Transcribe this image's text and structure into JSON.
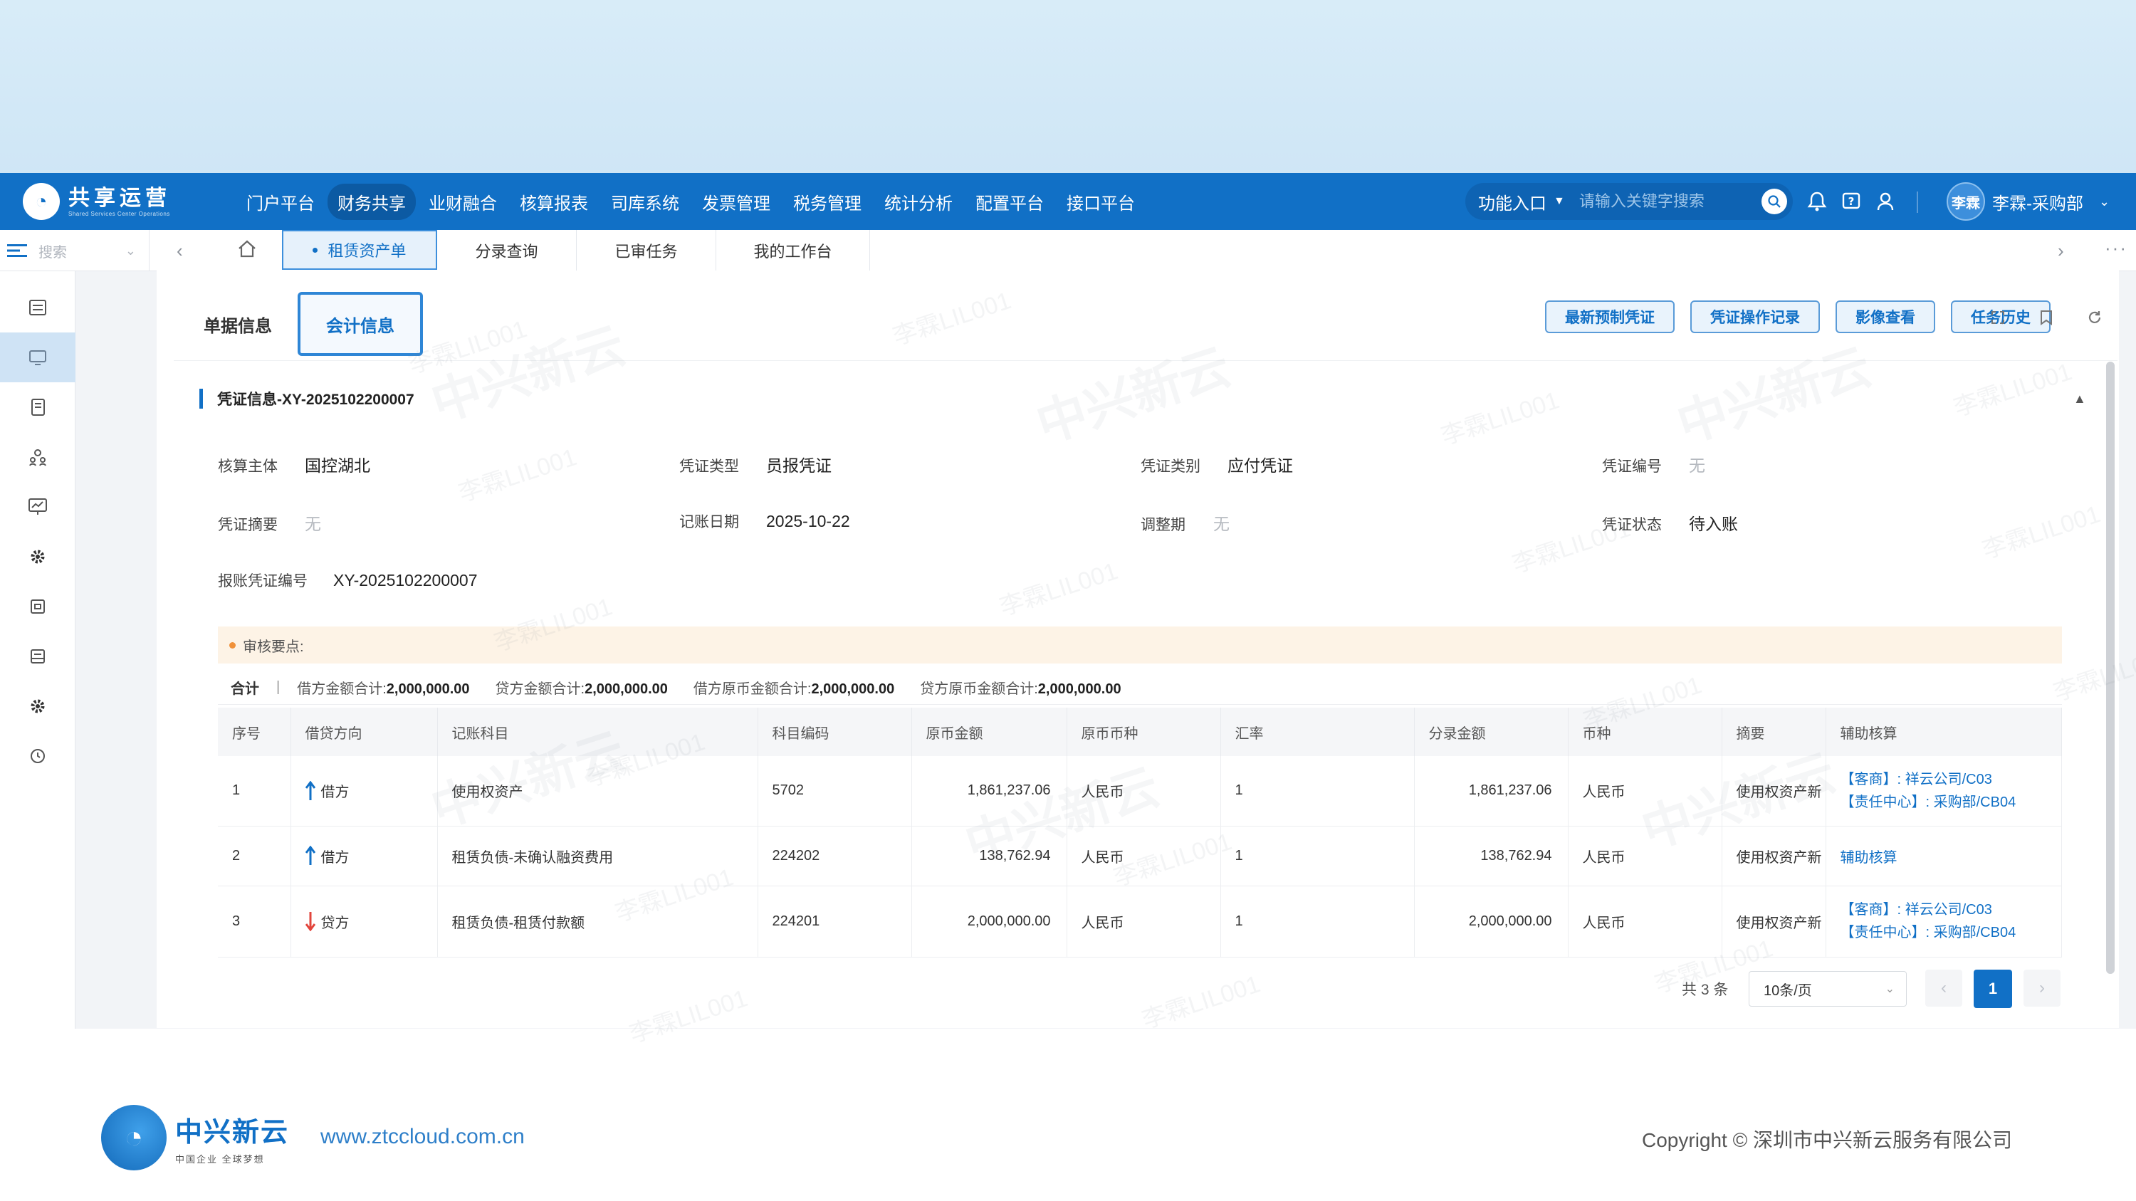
{
  "brand": {
    "name": "共享运营",
    "subtitle": "Shared Services Center Operations"
  },
  "nav": [
    "门户平台",
    "财务共享",
    "业财融合",
    "核算报表",
    "司库系统",
    "发票管理",
    "税务管理",
    "统计分析",
    "配置平台",
    "接口平台"
  ],
  "header": {
    "func_entry": "功能入口",
    "search_placeholder": "请输入关键字搜索",
    "user_avatar": "李霖",
    "user_name": "李霖-采购部"
  },
  "sidebar": {
    "search_label": "搜索"
  },
  "tabs": [
    "租赁资产单",
    "分录查询",
    "已审任务",
    "我的工作台"
  ],
  "panel_tabs": [
    "单据信息",
    "会计信息"
  ],
  "actions": [
    "最新预制凭证",
    "凭证操作记录",
    "影像查看",
    "任务历史"
  ],
  "voucher": {
    "title": "凭证信息-XY-2025102200007",
    "fields": {
      "entity_label": "核算主体",
      "entity": "国控湖北",
      "type_label": "凭证类型",
      "type": "员报凭证",
      "category_label": "凭证类别",
      "category": "应付凭证",
      "number_label": "凭证编号",
      "number": "无",
      "summary_label": "凭证摘要",
      "summary": "无",
      "date_label": "记账日期",
      "date": "2025-10-22",
      "period_label": "调整期",
      "period": "无",
      "status_label": "凭证状态",
      "status": "待入账",
      "report_label": "报账凭证编号",
      "report": "XY-2025102200007"
    }
  },
  "audit_label": "审核要点:",
  "totals": {
    "label": "合计",
    "items": [
      {
        "k": "借方金额合计:",
        "v": "2,000,000.00"
      },
      {
        "k": "贷方金额合计:",
        "v": "2,000,000.00"
      },
      {
        "k": "借方原币金额合计:",
        "v": "2,000,000.00"
      },
      {
        "k": "贷方原币金额合计:",
        "v": "2,000,000.00"
      }
    ]
  },
  "table": {
    "headers": [
      "序号",
      "借贷方向",
      "记账科目",
      "科目编码",
      "原币金额",
      "原币币种",
      "汇率",
      "分录金额",
      "币种",
      "摘要",
      "辅助核算"
    ],
    "rows": [
      {
        "no": "1",
        "dir": "借方",
        "subject": "使用权资产",
        "code": "5702",
        "orig": "1,861,237.06",
        "orig_cur": "人民币",
        "rate": "1",
        "amount": "1,861,237.06",
        "cur": "人民币",
        "summary": "使用权资产新",
        "aux1": "【客商】: 祥云公司/C03",
        "aux2": "【责任中心】: 采购部/CB04"
      },
      {
        "no": "2",
        "dir": "借方",
        "subject": "租赁负债-未确认融资费用",
        "code": "224202",
        "orig": "138,762.94",
        "orig_cur": "人民币",
        "rate": "1",
        "amount": "138,762.94",
        "cur": "人民币",
        "summary": "使用权资产新",
        "aux1": "辅助核算",
        "aux2": ""
      },
      {
        "no": "3",
        "dir": "贷方",
        "subject": "租赁负债-租赁付款额",
        "code": "224201",
        "orig": "2,000,000.00",
        "orig_cur": "人民币",
        "rate": "1",
        "amount": "2,000,000.00",
        "cur": "人民币",
        "summary": "使用权资产新",
        "aux1": "【客商】: 祥云公司/C03",
        "aux2": "【责任中心】: 采购部/CB04"
      }
    ]
  },
  "pager": {
    "total": "共 3 条",
    "size": "10条/页",
    "page": "1"
  },
  "watermark": {
    "text": "李霖LIL001",
    "brand": "中兴新云"
  },
  "footer": {
    "logo_name": "中兴新云",
    "logo_slogan": "中国企业 全球梦想",
    "url": "www.ztccloud.com.cn",
    "copyright": "Copyright © 深圳市中兴新云服务有限公司"
  },
  "colors": {
    "primary": "#1170c6",
    "debit_arrow": "#1170c6",
    "credit_arrow": "#e2453c",
    "audit_bg": "#fdf3e6"
  }
}
